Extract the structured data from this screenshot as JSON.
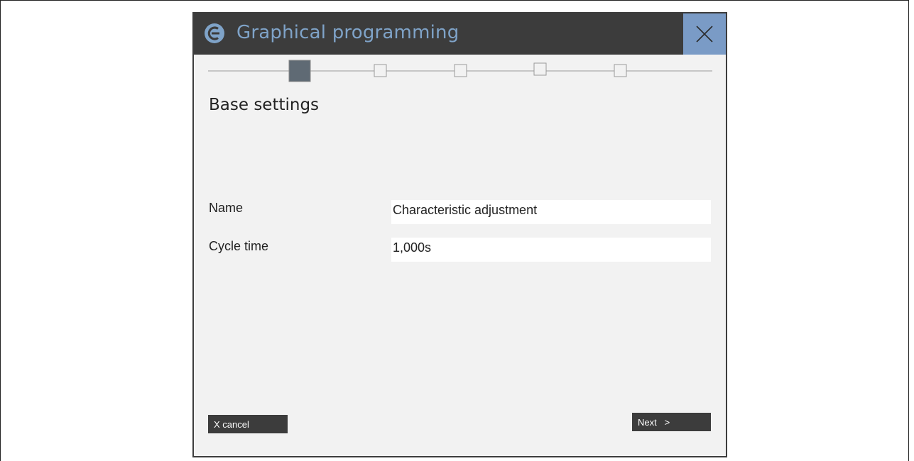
{
  "dialog": {
    "title": "Graphical programming",
    "heading": "Base settings",
    "close_icon": "close-icon",
    "app_icon": "app-logo-icon"
  },
  "stepper": {
    "total_steps": 5,
    "current_step": 1
  },
  "form": {
    "name_label": "Name",
    "name_value": "Characteristic adjustment",
    "cycle_time_label": "Cycle time",
    "cycle_time_value": "1,000s"
  },
  "footer": {
    "cancel_label": "X cancel",
    "next_label": "Next   >"
  },
  "colors": {
    "titlebar_bg": "#3c3c3c",
    "title_text": "#7fa3c8",
    "close_bg": "#7a9bc6",
    "dialog_bg": "#f2f2f2",
    "active_step": "#5f6a74"
  }
}
